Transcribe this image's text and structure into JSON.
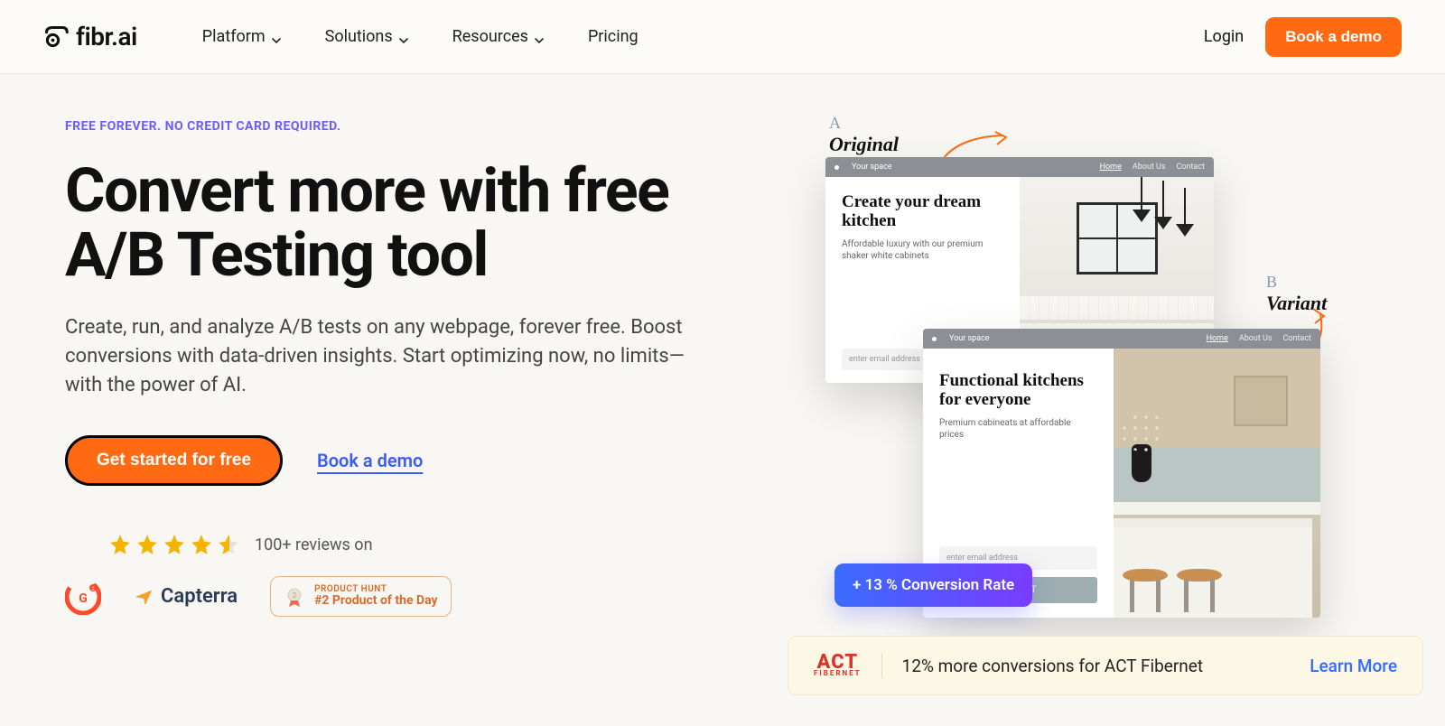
{
  "nav": {
    "logo_text": "fibr.ai",
    "items": [
      "Platform",
      "Solutions",
      "Resources",
      "Pricing"
    ],
    "login": "Login",
    "cta": "Book a demo"
  },
  "hero": {
    "eyebrow": "FREE FOREVER. NO CREDIT CARD REQUIRED.",
    "headline": "Convert more with free A/B Testing tool",
    "subhead": "Create, run, and analyze A/B tests on any webpage, forever free. Boost conversions with data-driven insights. Start optimizing now, no limits—with the power of AI.",
    "cta_primary": "Get started for free",
    "cta_secondary": "Book a demo",
    "reviews_text": "100+ reviews on",
    "capterra": "Capterra",
    "ph_small": "PRODUCT HUNT",
    "ph_big": "#2 Product of the Day"
  },
  "mock": {
    "a_letter": "A",
    "a_word": "Original",
    "b_letter": "B",
    "b_word": "Variant",
    "brand": "Your space",
    "navlinks": [
      "Home",
      "About Us",
      "Contact"
    ],
    "a_title": "Create your dream kitchen",
    "a_desc": "Affordable luxury with our premium shaker white cabinets",
    "b_title": "Functional kitchens for everyone",
    "b_desc": "Premium cabineats at affordable prices",
    "email_placeholder": "enter email address",
    "submit": "SUBMIT",
    "conversion": "+ 13 % Conversion Rate"
  },
  "banner": {
    "logo_big": "ACT",
    "logo_small": "FIBERNET",
    "msg": "12% more conversions for ACT Fibernet",
    "learn": "Learn More"
  }
}
